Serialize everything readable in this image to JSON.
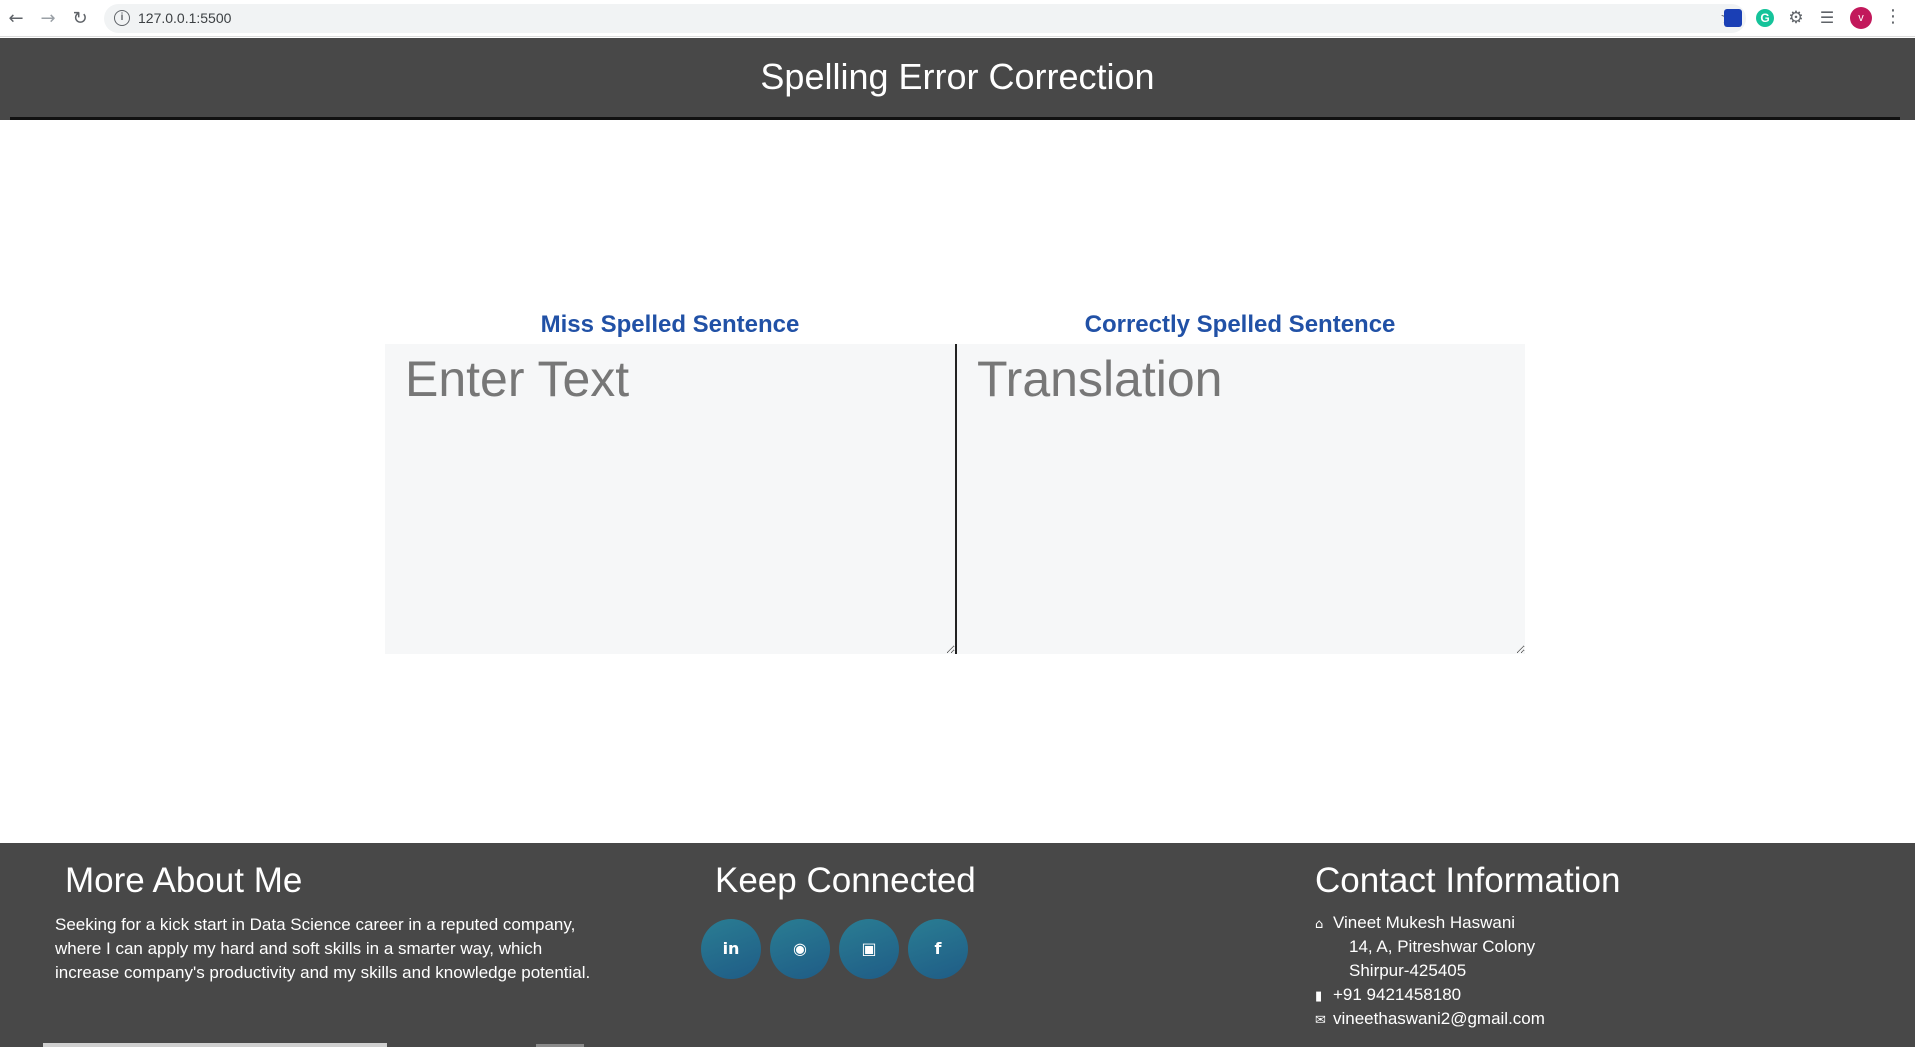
{
  "browser": {
    "url": "127.0.0.1:5500",
    "avatar_letter": "v",
    "icons": [
      "back-arrow-icon",
      "forward-arrow-icon",
      "reload-icon",
      "info-icon",
      "star-icon",
      "extension-icon",
      "grammarly-icon",
      "puzzle-icon",
      "playlist-icon",
      "menu-dots-icon"
    ]
  },
  "header": {
    "title": "Spelling Error Correction"
  },
  "main": {
    "left_label": "Miss Spelled Sentence",
    "left_placeholder": "Enter Text",
    "right_label": "Correctly Spelled Sentence",
    "right_placeholder": "Translation"
  },
  "footer": {
    "about": {
      "heading": "More About Me",
      "text": "Seeking for a kick start in Data Science career in a reputed company, where I can apply my hard and soft skills in a smarter way, which increase company's productivity and my skills and knowledge potential."
    },
    "connect": {
      "heading": "Keep Connected",
      "links": [
        "linkedin-icon",
        "github-icon",
        "instagram-icon",
        "facebook-icon"
      ]
    },
    "contact": {
      "heading": "Contact Information",
      "name": "Vineet Mukesh Haswani",
      "address_line1": "14, A, Pitreshwar Colony",
      "address_line2": "Shirpur-425405",
      "phone": "+91 9421458180",
      "email": "vineethaswani2@gmail.com"
    }
  },
  "colors": {
    "header_bg": "#484848",
    "label_blue": "#2151a6",
    "textarea_bg": "#f6f7f8"
  }
}
